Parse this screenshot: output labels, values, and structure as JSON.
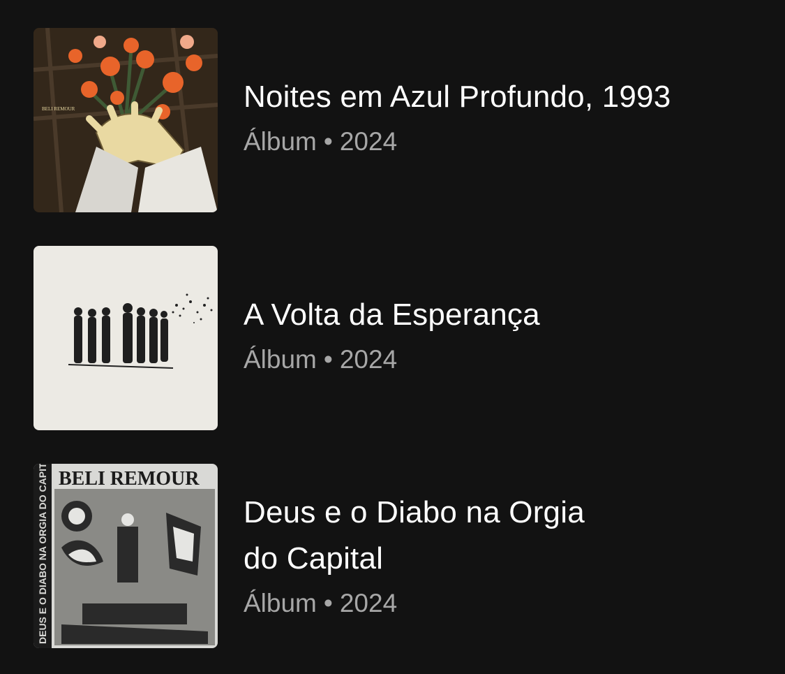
{
  "albums": [
    {
      "title": "Noites em Azul Profundo, 1993",
      "type": "Álbum",
      "year": "2024",
      "cover": {
        "icon": "album-cover-flowers",
        "text": "BELI REMOUR"
      }
    },
    {
      "title": "A Volta da Esperança",
      "type": "Álbum",
      "year": "2024",
      "cover": {
        "icon": "album-cover-figures"
      }
    },
    {
      "title_line1": "Deus e o Diabo na Orgia",
      "title_line2": "do Capital",
      "type": "Álbum",
      "year": "2024",
      "cover": {
        "icon": "album-cover-engraving",
        "text": "BELI REMOUR",
        "spine": "DEUS E O DIABO NA ORGIA DO CAPITAL"
      }
    }
  ],
  "separator": "•",
  "colors": {
    "background": "#121212",
    "title": "#ffffff",
    "subtitle": "#a7a7a7"
  }
}
